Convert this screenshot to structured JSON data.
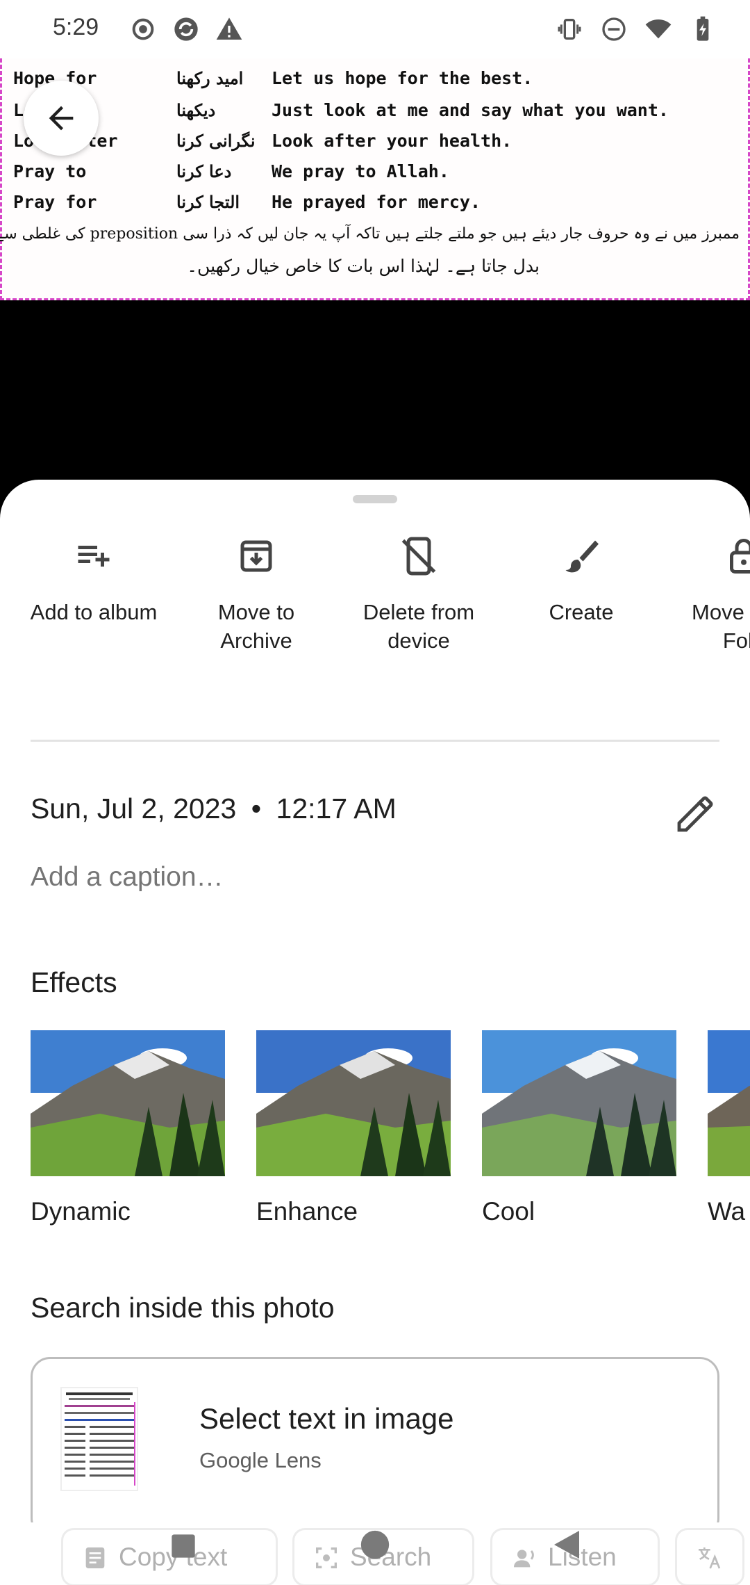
{
  "status_bar": {
    "time": "5:29"
  },
  "document": {
    "rows": [
      {
        "c1": "Hope for",
        "c2": "امید رکھنا",
        "c3": "Let us hope for the best."
      },
      {
        "c1": "Look",
        "c2": "دیکھنا",
        "c3": "Just look at me and say what you want."
      },
      {
        "c1": "Look after",
        "c2": "نگرانی کرنا",
        "c3": "Look after your health."
      },
      {
        "c1": "Pray to",
        "c2": "دعا کرنا",
        "c3": "We pray to Allah."
      },
      {
        "c1": "Pray for",
        "c2": "التجا کرنا",
        "c3": "He prayed for mercy."
      }
    ],
    "urdu_line1": "ممبرز میں نے وہ حروف جار دیئے ہیں جو ملتے جلتے ہیں تاکہ آپ یہ جان لیں کہ ذرا سی preposition کی غلطی سے جملے کی ہیئت اور مفہوم",
    "urdu_line2": "بدل جاتا ہے۔ لہٰذا اس بات کا خاص خیال رکھیں۔"
  },
  "actions": [
    {
      "icon": "playlist-add-icon",
      "label": "Add to album"
    },
    {
      "icon": "archive-icon",
      "label": "Move to Archive"
    },
    {
      "icon": "delete-from-device-icon",
      "label": "Delete from device"
    },
    {
      "icon": "brush-icon",
      "label": "Create"
    },
    {
      "icon": "lock-icon",
      "label": "Move Lock Fold"
    }
  ],
  "details": {
    "date": "Sun, Jul 2, 2023",
    "separator": "•",
    "time": "12:17 AM",
    "caption_placeholder": "Add a caption…"
  },
  "effects": {
    "title": "Effects",
    "items": [
      {
        "label": "Dynamic"
      },
      {
        "label": "Enhance"
      },
      {
        "label": "Cool"
      },
      {
        "label": "Wa"
      }
    ]
  },
  "search": {
    "title": "Search inside this photo",
    "lens_title": "Select text in image",
    "lens_subtitle": "Google Lens",
    "chips": [
      "Copy text",
      "Search",
      "Listen"
    ]
  },
  "colors": {
    "doc_border": "#d646c8",
    "sheet_bg": "#ffffff",
    "text_primary": "#1f1f1f",
    "text_secondary": "#757575"
  }
}
